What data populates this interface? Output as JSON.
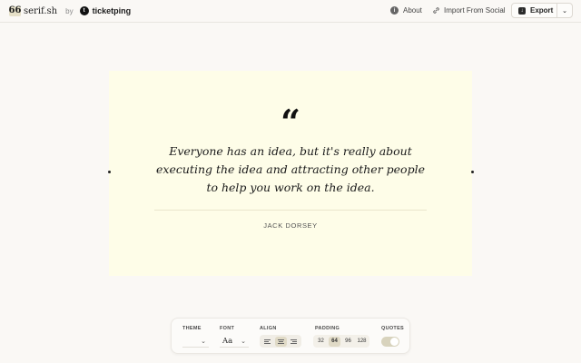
{
  "header": {
    "brand_logo": "66",
    "brand_name": "serif.sh",
    "by": "by",
    "partner_name": "ticketping",
    "about": "About",
    "import": "Import From Social",
    "export": "Export"
  },
  "quote": {
    "mark": "“",
    "text": "Everyone has an idea, but it's really about executing the idea and attracting other people to help you work on the idea.",
    "author": "JACK DORSEY"
  },
  "toolbar": {
    "theme_label": "THEME",
    "font_label": "FONT",
    "font_sample": "Aa",
    "align_label": "ALIGN",
    "padding_label": "PADDING",
    "quotes_label": "QUOTES",
    "padding_options": [
      "32",
      "64",
      "96",
      "128"
    ],
    "padding_selected": "64",
    "align_selected": "center",
    "quotes_enabled": true
  },
  "colors": {
    "page_background": "#faf8f5",
    "card_background": "#fefde8",
    "accent": "#e0dac6"
  }
}
